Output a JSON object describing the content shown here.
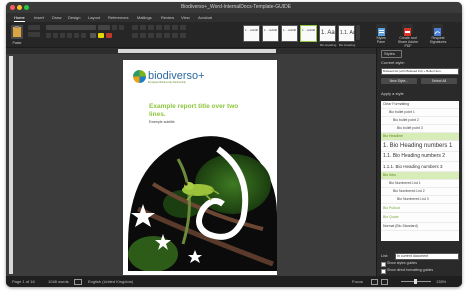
{
  "window": {
    "title": "Biodiverso+_Word-InternalDocs-Template-GUIDE"
  },
  "menu_tabs": [
    "Home",
    "Insert",
    "Draw",
    "Design",
    "Layout",
    "References",
    "Mailings",
    "Review",
    "View",
    "Acrobat"
  ],
  "ribbon": {
    "paste_label": "Paste",
    "styles": [
      {
        "preview": "1. ·.subtitl",
        "name": ""
      },
      {
        "preview": "1. ·.subtitl",
        "name": ""
      },
      {
        "preview": "1. ·.subtitl",
        "name": ""
      },
      {
        "preview": "1. ·.subtitl",
        "name": ""
      },
      {
        "preview": "1. Aa",
        "name": "Bio Heading"
      },
      {
        "preview": "1.1. Aa",
        "name": "Bio Heading"
      }
    ],
    "styles_pane_label": "Styles Pane",
    "create_share_label": "Create and Share Adobe PDF",
    "request_sign_label": "Request Signatures"
  },
  "document": {
    "logo_text": "biodiverso+",
    "logo_subtext": "European Biodiversity Partnership",
    "title": "Example report title over two lines.",
    "subtitle": "Example subtitle"
  },
  "styles_pane": {
    "header": "Styles",
    "current_style_label": "Current style:",
    "current_style_value": "Bulleted list (with Bulleted list) + Bullet Num.",
    "new_style_label": "New Style...",
    "select_all_label": "Select All",
    "apply_style_label": "Apply a style",
    "styles": [
      {
        "label": "Clear Formatting",
        "selected": false
      },
      {
        "label": "Bio bullet point 1",
        "selected": false
      },
      {
        "label": "Bio bullet point 2",
        "selected": false
      },
      {
        "label": "Bio bullet point 3",
        "selected": false
      },
      {
        "label": "Bio Headline",
        "selected": true
      },
      {
        "label": "1. Bio Heading numbers 1",
        "selected": false
      },
      {
        "label": "1.1. Bio Heading numbers 2",
        "selected": false
      },
      {
        "label": "1.1.1. Bio Heading numbers 3",
        "selected": false
      },
      {
        "label": "Bio Intro",
        "selected": true
      },
      {
        "label": "Bio Numbered List 1",
        "selected": false
      },
      {
        "label": "Bio Numbered List 2",
        "selected": false
      },
      {
        "label": "Bio Numbered List 3",
        "selected": false
      },
      {
        "label": "Bio Pullout",
        "selected": false
      },
      {
        "label": "Bio Quote",
        "selected": false
      },
      {
        "label": "Normal (Bio Standard)",
        "selected": false
      }
    ],
    "list_label": "List:",
    "list_value": "In current document",
    "show_guides_label": "Show styles guides",
    "show_direct_label": "Show direct formatting guides"
  },
  "status_bar": {
    "page": "Page 1 of 16",
    "words": "1048 words",
    "language": "English (United Kingdom)",
    "focus": "Focus",
    "zoom": "135%"
  },
  "colors": {
    "accent_green": "#8dc63f",
    "logo_blue": "#2c6aa0",
    "window_dark": "#2b2b2b"
  }
}
